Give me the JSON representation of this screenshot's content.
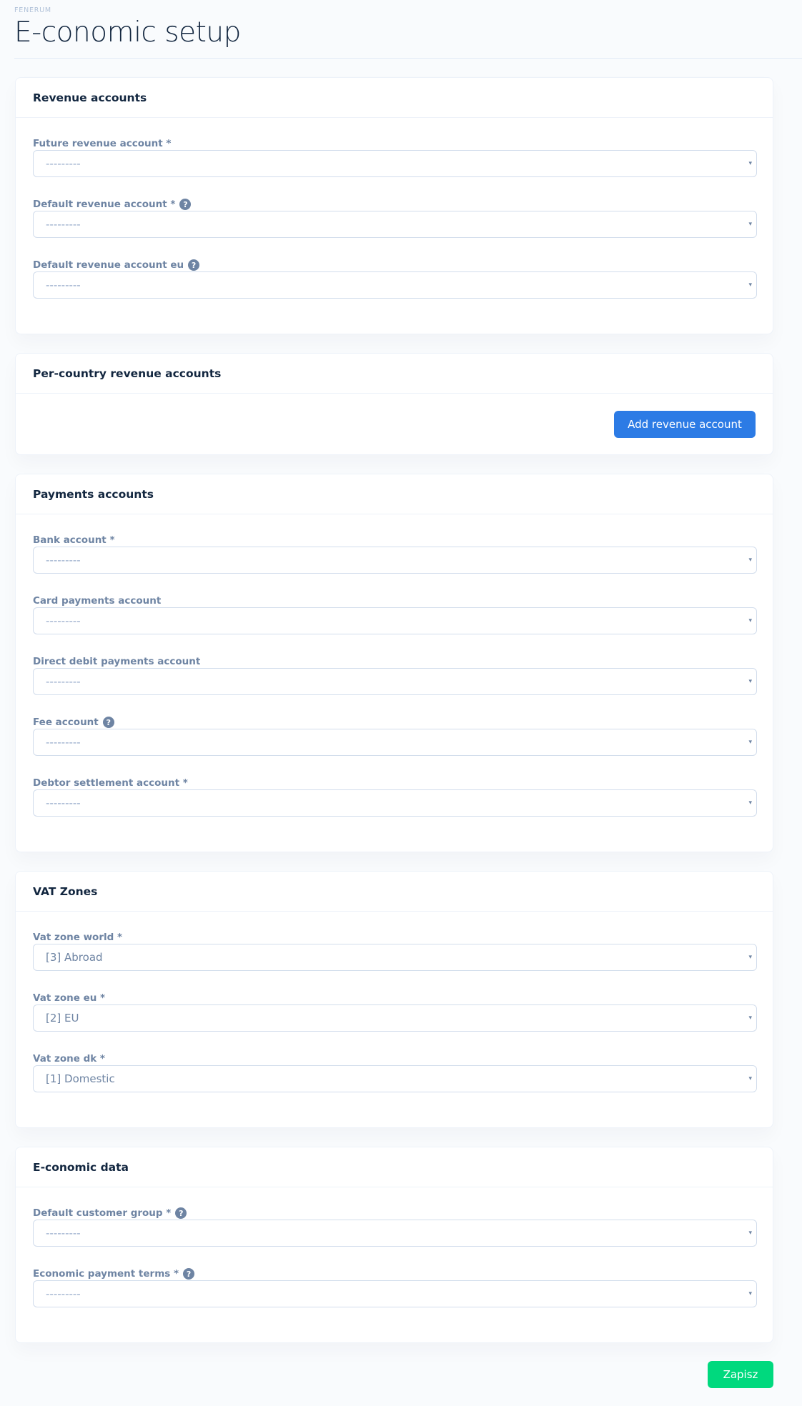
{
  "header": {
    "pretitle": "FENERUM",
    "title": "E-conomic setup"
  },
  "revenue": {
    "title": "Revenue accounts",
    "fields": [
      {
        "label": "Future revenue account *",
        "value": "---------",
        "help": false
      },
      {
        "label": "Default revenue account *",
        "value": "---------",
        "help": true
      },
      {
        "label": "Default revenue account eu",
        "value": "---------",
        "help": true
      }
    ]
  },
  "per_country": {
    "title": "Per-country revenue accounts",
    "add_button": "Add revenue account"
  },
  "payments": {
    "title": "Payments accounts",
    "fields": [
      {
        "label": "Bank account *",
        "value": "---------",
        "help": false
      },
      {
        "label": "Card payments account",
        "value": "---------",
        "help": false
      },
      {
        "label": "Direct debit payments account",
        "value": "---------",
        "help": false
      },
      {
        "label": "Fee account",
        "value": "---------",
        "help": true
      },
      {
        "label": "Debtor settlement account *",
        "value": "---------",
        "help": false
      }
    ]
  },
  "vat": {
    "title": "VAT Zones",
    "fields": [
      {
        "label": "Vat zone world *",
        "value": "[3] Abroad",
        "help": false
      },
      {
        "label": "Vat zone eu *",
        "value": "[2] EU",
        "help": false
      },
      {
        "label": "Vat zone dk *",
        "value": "[1] Domestic",
        "help": false
      }
    ]
  },
  "economic_data": {
    "title": "E-conomic data",
    "fields": [
      {
        "label": "Default customer group *",
        "value": "---------",
        "help": true
      },
      {
        "label": "Economic payment terms *",
        "value": "---------",
        "help": true
      }
    ]
  },
  "icons": {
    "help": "question-circle-icon",
    "select_caret": "caret-down-icon",
    "help_glyph": "?",
    "caret_glyph": "▾"
  },
  "colors": {
    "primary": "#2c7be5",
    "success": "#00d97e",
    "label": "#6e84a3",
    "placeholder": "#95aac9"
  },
  "footer": {
    "save_label": "Zapisz"
  }
}
